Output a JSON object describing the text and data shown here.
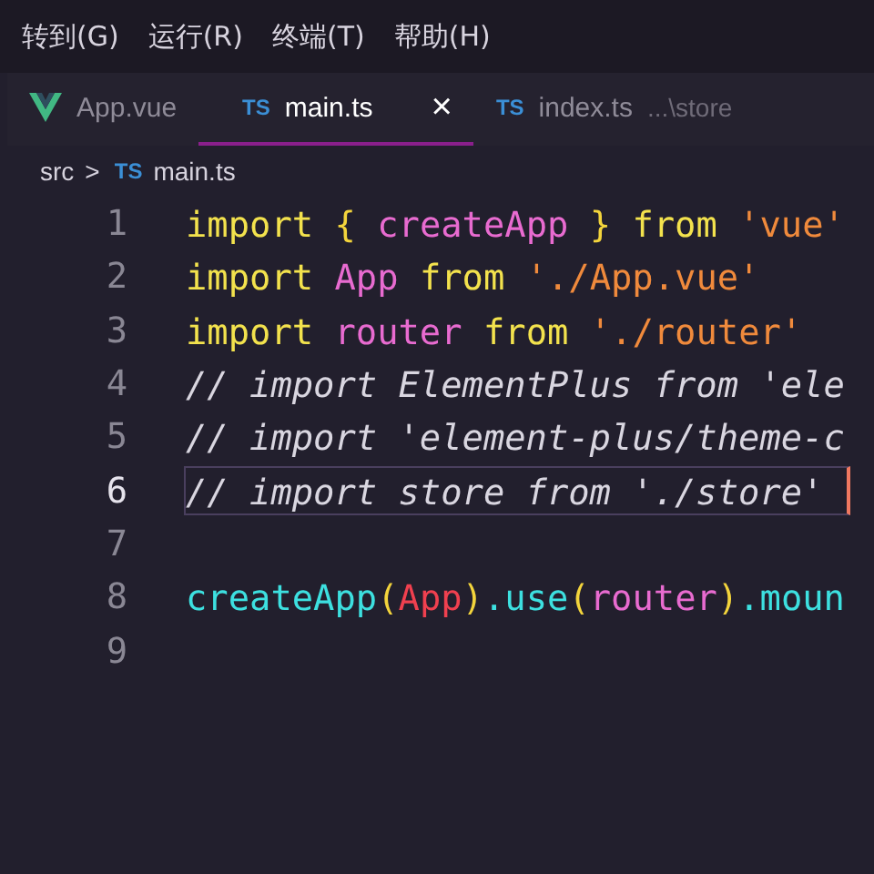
{
  "menu": [
    "转到(G)",
    "运行(R)",
    "终端(T)",
    "帮助(H)"
  ],
  "tabs": [
    {
      "kind": "vue",
      "label": "App.vue",
      "selected": false
    },
    {
      "kind": "ts",
      "badge": "TS",
      "label": "main.ts",
      "close": "×",
      "selected": true
    },
    {
      "kind": "ts",
      "badge": "TS",
      "label": "index.ts",
      "path": "...\\store",
      "selected": false
    }
  ],
  "breadcrumb": {
    "folder": "src",
    "separator": ">",
    "badge": "TS",
    "file": "main.ts"
  },
  "lines": [
    {
      "number": "1",
      "current": false,
      "tokens": [
        {
          "text": "import ",
          "kind": "keyword"
        },
        {
          "text": "{ ",
          "kind": "punct"
        },
        {
          "text": "createApp",
          "kind": "variable"
        },
        {
          "text": " } ",
          "kind": "punct"
        },
        {
          "text": "from ",
          "kind": "keyword"
        },
        {
          "text": "'vue'",
          "kind": "string"
        }
      ]
    },
    {
      "number": "2",
      "current": false,
      "tokens": [
        {
          "text": "import ",
          "kind": "keyword"
        },
        {
          "text": "App ",
          "kind": "variable"
        },
        {
          "text": "from ",
          "kind": "keyword"
        },
        {
          "text": "'./App.vue'",
          "kind": "string"
        }
      ]
    },
    {
      "number": "3",
      "current": false,
      "tokens": [
        {
          "text": "import ",
          "kind": "keyword"
        },
        {
          "text": "router ",
          "kind": "variable"
        },
        {
          "text": "from ",
          "kind": "keyword"
        },
        {
          "text": "'./router'",
          "kind": "string"
        }
      ]
    },
    {
      "number": "4",
      "current": false,
      "tokens": [
        {
          "text": "// import ElementPlus from 'ele",
          "kind": "comment"
        }
      ]
    },
    {
      "number": "5",
      "current": false,
      "tokens": [
        {
          "text": "// import 'element-plus/theme-c",
          "kind": "comment"
        }
      ]
    },
    {
      "number": "6",
      "current": true,
      "tokens": [
        {
          "text": "// import store from './store'",
          "kind": "comment"
        }
      ]
    },
    {
      "number": "7",
      "current": false
    },
    {
      "number": "8",
      "current": false,
      "tokens": [
        {
          "text": "createApp",
          "kind": "function"
        },
        {
          "text": "(",
          "kind": "punct"
        },
        {
          "text": "App",
          "kind": "class"
        },
        {
          "text": ")",
          "kind": "punct"
        },
        {
          "text": ".use",
          "kind": "function"
        },
        {
          "text": "(",
          "kind": "punct"
        },
        {
          "text": "router",
          "kind": "variable"
        },
        {
          "text": ")",
          "kind": "punct"
        },
        {
          "text": ".moun",
          "kind": "function"
        }
      ]
    },
    {
      "number": "9",
      "current": false
    }
  ]
}
